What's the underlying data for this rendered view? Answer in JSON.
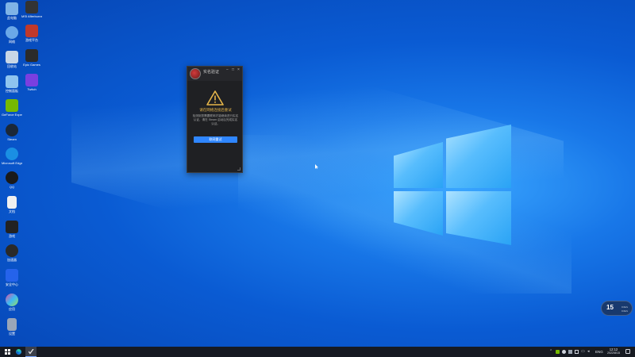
{
  "desktop": {
    "icons": [
      {
        "label": "此电脑",
        "icon": "computer-icon",
        "color": "#7fb3e6"
      },
      {
        "label": "网络",
        "icon": "network-icon",
        "color": "#6aa8e8"
      },
      {
        "label": "回收站",
        "icon": "recycle-bin-icon",
        "color": "#c8d6e6"
      },
      {
        "label": "控制面板",
        "icon": "control-panel-icon",
        "color": "#8fc4ef"
      },
      {
        "label": "GeForce Experience",
        "icon": "nvidia-icon",
        "color": "#76b900"
      },
      {
        "label": "Steam",
        "icon": "steam-icon",
        "color": "#1b2838"
      },
      {
        "label": "Microsoft Edge",
        "icon": "edge-icon",
        "color": "#1a8fe3"
      },
      {
        "label": "QQ",
        "icon": "qq-icon",
        "color": "#1a1a1a"
      },
      {
        "label": "文档",
        "icon": "document-icon",
        "color": "#f0f0f0"
      },
      {
        "label": "游戏",
        "icon": "game-icon",
        "color": "#222222"
      },
      {
        "label": "加速器",
        "icon": "accelerator-icon",
        "color": "#2a2a2a"
      },
      {
        "label": "安全中心",
        "icon": "shield-icon",
        "color": "#2563eb"
      },
      {
        "label": "应用",
        "icon": "colorful-app-icon",
        "color": "#e04fa0"
      },
      {
        "label": "设置",
        "icon": "settings-app-icon",
        "color": "#9aa6b8"
      },
      {
        "label": "MSI Afterburner",
        "icon": "afterburner-icon",
        "color": "#333333"
      },
      {
        "label": "游戏平台",
        "icon": "game-platform-icon",
        "color": "#c0392b"
      },
      {
        "label": "Epic Games",
        "icon": "epic-icon",
        "color": "#2b2b2b"
      },
      {
        "label": "Twitch",
        "icon": "twitch-icon",
        "color": "#7a3fe0"
      }
    ]
  },
  "dialog": {
    "title": "实名验证",
    "subtitle": "",
    "heading": "请在网络连接后重试",
    "body": "检测到您需要联网才能继续进行实名认证，请在 Steam 启动后完成实名认证。",
    "button_label": "联网重试",
    "minimize": "−",
    "maximize": "□",
    "close": "×"
  },
  "widget": {
    "number": "15",
    "line1": "0.0k/s",
    "line2": "0.0k/s"
  },
  "taskbar": {
    "ime": "ENG",
    "time": "12:12",
    "date": "2022/8/15"
  },
  "colors": {
    "accent": "#2f86ff",
    "warning": "#e5b54a",
    "dialog_bg": "#1f2023"
  }
}
